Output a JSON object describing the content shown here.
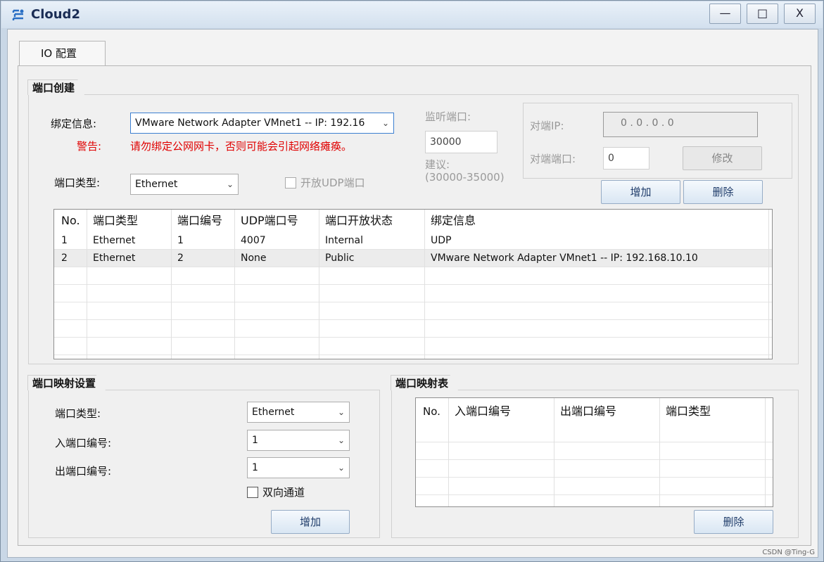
{
  "window": {
    "title": "Cloud2",
    "minimize": "—",
    "maximize": "□",
    "close": "X"
  },
  "tab": {
    "label": "IO 配置"
  },
  "port_create": {
    "group_label": "端口创建",
    "bind_label": "绑定信息:",
    "bind_value": "VMware Network Adapter VMnet1 -- IP: 192.16",
    "warn_label": "警告:",
    "warn_text": "请勿绑定公网网卡，否则可能会引起网络瘫痪。",
    "port_type_label": "端口类型:",
    "port_type_value": "Ethernet",
    "udp_checkbox_label": "开放UDP端口",
    "listen_label": "监听端口:",
    "listen_value": "30000",
    "suggest_label": "建议:",
    "suggest_range": "(30000-35000)",
    "peer_ip_label": "对端IP:",
    "peer_ip_value": "0  .  0  .  0  .  0",
    "peer_port_label": "对端端口:",
    "peer_port_value": "0",
    "modify_button": "修改",
    "add_button": "增加",
    "delete_button": "删除",
    "table": {
      "headers": [
        "No.",
        "端口类型",
        "端口编号",
        "UDP端口号",
        "端口开放状态",
        "绑定信息"
      ],
      "rows": [
        [
          "1",
          "Ethernet",
          "1",
          "4007",
          "Internal",
          "UDP"
        ],
        [
          "2",
          "Ethernet",
          "2",
          "None",
          "Public",
          "VMware Network Adapter VMnet1 -- IP: 192.168.10.10"
        ]
      ]
    }
  },
  "port_map_settings": {
    "group_label": "端口映射设置",
    "port_type_label": "端口类型:",
    "port_type_value": "Ethernet",
    "in_port_label": "入端口编号:",
    "in_port_value": "1",
    "out_port_label": "出端口编号:",
    "out_port_value": "1",
    "bidirectional_label": "双向通道",
    "add_button": "增加"
  },
  "port_map_table": {
    "group_label": "端口映射表",
    "headers": [
      "No.",
      "入端口编号",
      "出端口编号",
      "端口类型"
    ],
    "delete_button": "删除"
  },
  "footer": {
    "watermark": "CSDN @Ting-G"
  }
}
